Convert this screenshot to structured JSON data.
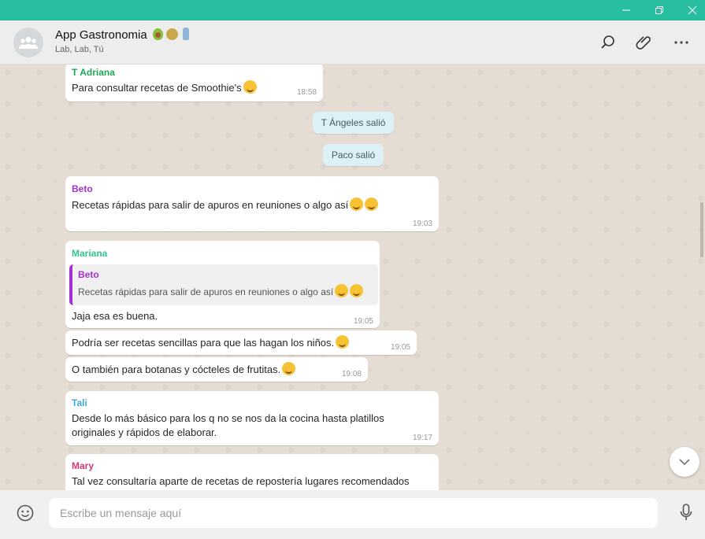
{
  "window": {
    "minimize_icon": "minimize-icon",
    "maximize_icon": "maximize-icon",
    "close_icon": "close-icon",
    "accent": "#28bfa0"
  },
  "header": {
    "title": "App Gastronomia",
    "subtitle": "Lab, Lab, Tú",
    "icons": [
      "group-avatar-icon",
      "search-icon",
      "attach-icon",
      "menu-icon"
    ]
  },
  "messages": [
    {
      "sender": "T Adriana",
      "sender_color": "#1fa855",
      "text": "Para consultar recetas de Smoothie's",
      "time": "18:58"
    },
    {
      "system": "T Ángeles salió"
    },
    {
      "system": "Paco salió"
    },
    {
      "sender": "Beto",
      "sender_color": "#a52fd3",
      "text": "Recetas rápidas para salir de apuros en reuniones o algo así",
      "time": "19:03"
    },
    {
      "sender": "Mariana",
      "sender_color": "#35c48e",
      "quote_sender": "Beto",
      "quote_text": "Recetas rápidas para salir de apuros en reuniones o algo así",
      "text": "Jaja esa es buena.",
      "time": "19:05"
    },
    {
      "text": "Podría ser recetas sencillas para que las hagan los niños.",
      "time": "19:05"
    },
    {
      "text": "O también para botanas y cócteles de frutitas.",
      "time": "19:08"
    },
    {
      "sender": "Tali",
      "sender_color": "#3fa9d8",
      "line1": "Desde lo más básico para los q no se nos da la cocina hasta platillos",
      "line2": "originales y rápidos de elaborar.",
      "time": "19:17"
    },
    {
      "sender": "Mary",
      "sender_color": "#d4387a",
      "text": "Tal vez consultaría aparte de recetas de repostería lugares recomendados"
    }
  ],
  "composer": {
    "placeholder": "Escribe un mensaje aquí",
    "emoji_icon": "emoji-icon",
    "mic_icon": "microphone-icon"
  },
  "scroll_down_icon": "chevron-down-icon"
}
